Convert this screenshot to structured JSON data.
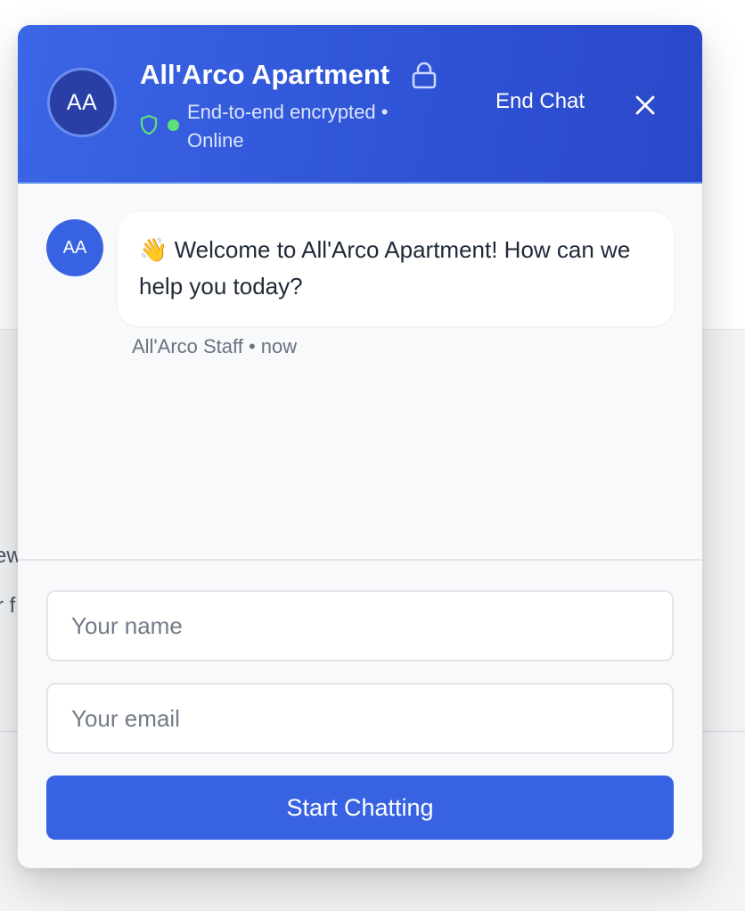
{
  "background": {
    "fragment_1": "ew",
    "fragment_2": "r f"
  },
  "chat": {
    "header": {
      "avatar_initials": "AA",
      "title": "All'Arco Apartment",
      "status_text": "End-to-end encrypted • Online",
      "end_chat_label": "End Chat",
      "icons": [
        "lock-icon",
        "shield-icon",
        "online-dot",
        "close-icon"
      ]
    },
    "messages": [
      {
        "avatar_initials": "AA",
        "text": "👋 Welcome to All'Arco Apartment! How can we help you today?",
        "meta": "All'Arco Staff • now"
      }
    ],
    "form": {
      "name_placeholder": "Your name",
      "email_placeholder": "Your email",
      "submit_label": "Start Chatting"
    }
  },
  "colors": {
    "header_gradient_start": "#3b66e6",
    "header_gradient_end": "#2a47c9",
    "accent": "#3763e3",
    "online": "#5ee07a"
  }
}
